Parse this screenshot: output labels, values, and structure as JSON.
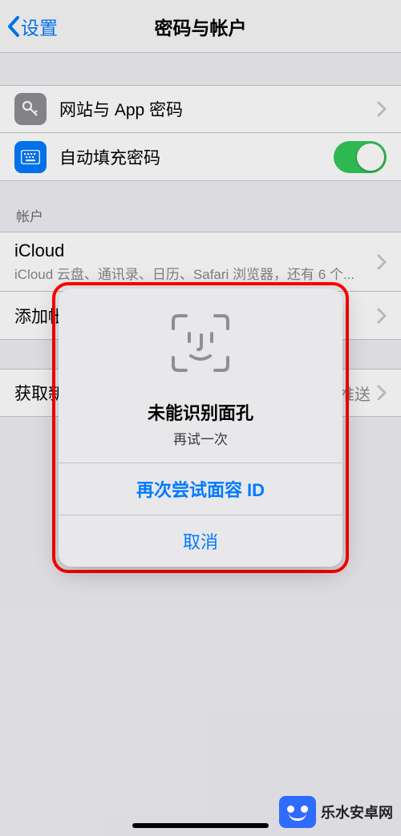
{
  "nav": {
    "back_label": "设置",
    "title": "密码与帐户"
  },
  "rows": {
    "passwords": {
      "label": "网站与 App 密码"
    },
    "autofill": {
      "label": "自动填充密码",
      "enabled": true
    }
  },
  "accounts": {
    "header": "帐户",
    "icloud": {
      "title": "iCloud",
      "detail": "iCloud 云盘、通讯录、日历、Safari 浏览器，还有 6 个..."
    },
    "add": {
      "label": "添加帐"
    },
    "fetch": {
      "label": "获取新",
      "value": "推送"
    }
  },
  "alert": {
    "title": "未能识别面孔",
    "subtitle": "再试一次",
    "retry": "再次尝试面容 ID",
    "cancel": "取消"
  },
  "watermark": {
    "text": "乐水安卓网"
  }
}
